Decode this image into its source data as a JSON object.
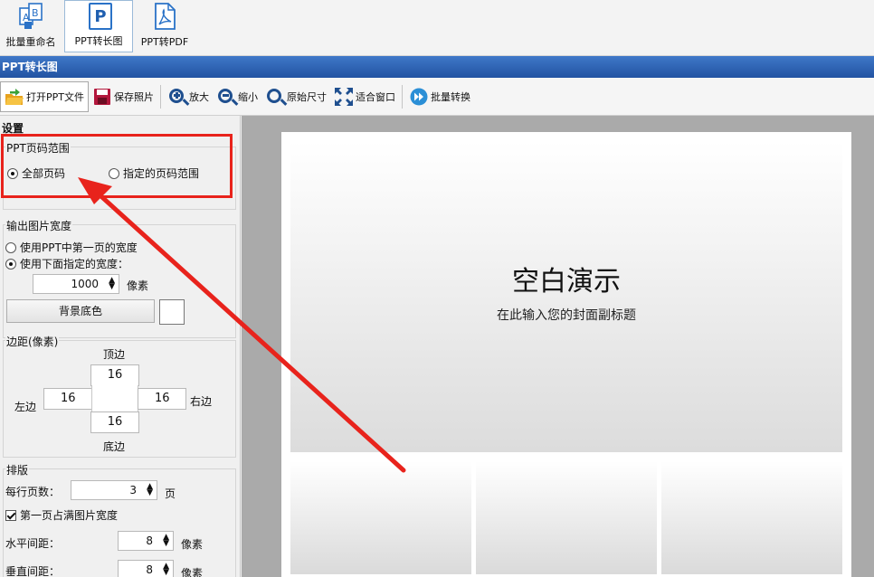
{
  "ribbon": {
    "items": [
      {
        "label": "批量重命名",
        "icon": "rename-docs-icon"
      },
      {
        "label": "PPT转长图",
        "icon": "ppt-icon"
      },
      {
        "label": "PPT转PDF",
        "icon": "pdf-icon"
      }
    ]
  },
  "title_bar": {
    "title": "PPT转长图"
  },
  "toolbar": {
    "open": "打开PPT文件",
    "save": "保存照片",
    "zoom_in": "放大",
    "zoom_out": "缩小",
    "original": "原始尺寸",
    "fit": "适合窗口",
    "batch": "批量转换"
  },
  "settings": {
    "title": "设置",
    "page_range": {
      "legend": "PPT页码范围",
      "all": "全部页码",
      "specified": "指定的页码范围",
      "selected": "all"
    },
    "width": {
      "legend": "输出图片宽度",
      "use_first": "使用PPT中第一页的宽度",
      "use_below": "使用下面指定的宽度：",
      "value": "1000",
      "unit": "像素",
      "bg_button": "背景底色",
      "bg_color": "#ffffff"
    },
    "margins": {
      "legend": "边距(像素)",
      "top_label": "顶边",
      "bottom_label": "底边",
      "left_label": "左边",
      "right_label": "右边",
      "top": "16",
      "bottom": "16",
      "left": "16",
      "right": "16"
    },
    "layout": {
      "legend": "排版",
      "per_row_label": "每行页数：",
      "per_row": "3",
      "per_row_unit": "页",
      "first_full": "第一页占满图片宽度",
      "first_full_checked": true,
      "h_gap_label": "水平间距：",
      "h_gap": "8",
      "v_gap_label": "垂直间距：",
      "v_gap": "8",
      "gap_unit": "像素"
    }
  },
  "preview": {
    "title": "空白演示",
    "subtitle": "在此输入您的封面副标题"
  },
  "colors": {
    "accent": "#2a5fae",
    "annotation": "#e8231c"
  }
}
